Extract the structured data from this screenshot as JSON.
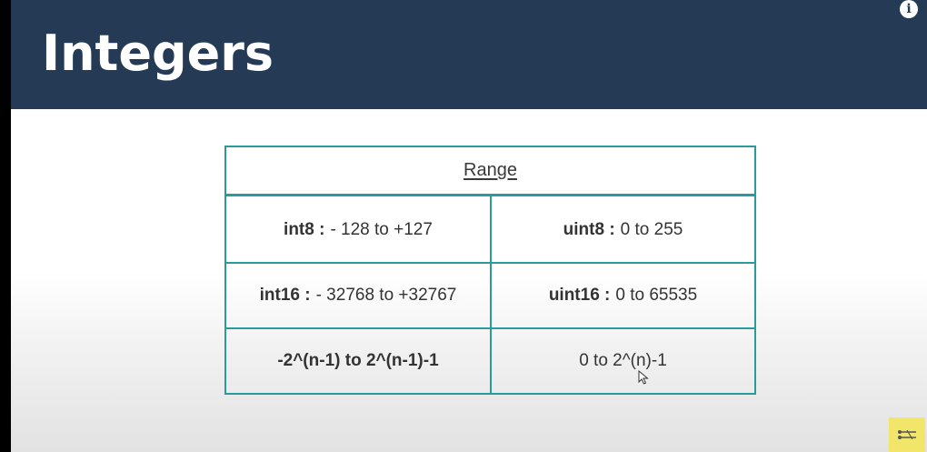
{
  "slide": {
    "title": "Integers"
  },
  "info_icon": {
    "glyph": "i",
    "icon": "info-icon"
  },
  "table": {
    "header": "Range",
    "rows": [
      {
        "left_bold": "int8 :",
        "left_text": "- 128 to +127",
        "right_bold": "uint8 :",
        "right_text": "0 to 255"
      },
      {
        "left_bold": "int16 :",
        "left_text": "- 32768 to +32767",
        "right_bold": "uint16 :",
        "right_text": "0 to 65535"
      },
      {
        "left_bold": "-2^(n-1) to 2^(n-1)-1",
        "left_text": "",
        "right_bold": "",
        "right_text": "0 to 2^(n)-1"
      }
    ]
  },
  "colors": {
    "header_bg": "#243a55",
    "table_border": "#2a9b9b",
    "badge_bg": "#f2e66a"
  }
}
